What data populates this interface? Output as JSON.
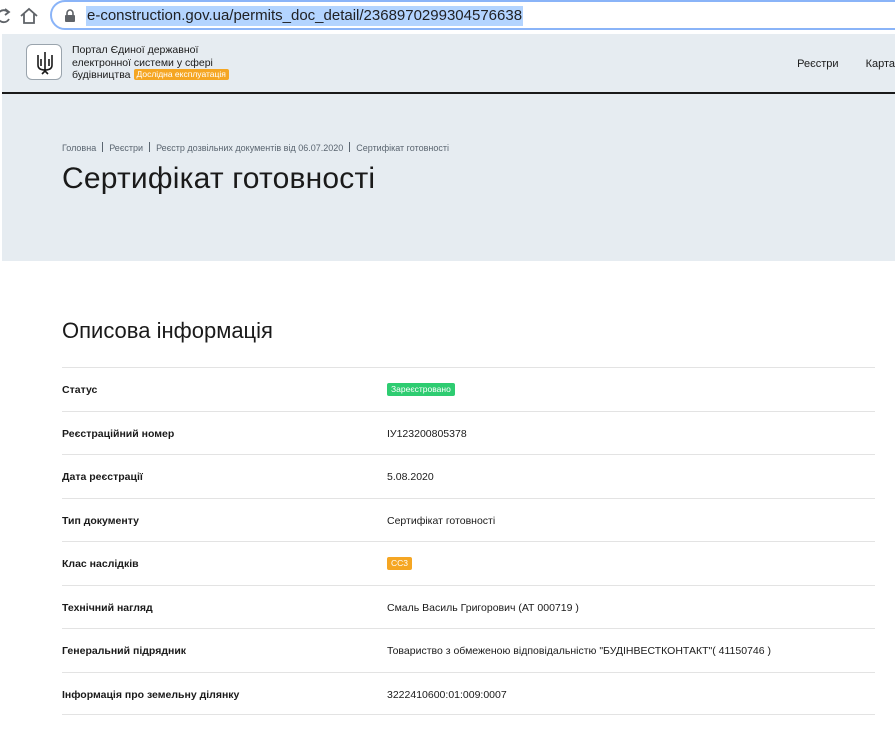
{
  "browser": {
    "url": "e-construction.gov.ua/permits_doc_detail/2368970299304576638",
    "reload_icon": "reload-icon",
    "home_icon": "home-icon",
    "lock_icon": "lock-icon"
  },
  "header": {
    "portal_name_lines": [
      "Портал Єдиної державної",
      "електронної системи у сфері",
      "будівництва"
    ],
    "beta_badge": "Дослідна експлуатація",
    "nav": [
      "Реєстри",
      "Карта"
    ],
    "emblem_icon": "trident-icon",
    "colors": {
      "header_bg": "#e6ecf1",
      "beta_badge": "#f5a623"
    }
  },
  "breadcrumb": [
    "Головна",
    "Реєстри",
    "Реєстр дозвільних документів від 06.07.2020",
    "Сертифікат готовності"
  ],
  "page_title": "Сертифікат готовності",
  "section_title": "Описова інформація",
  "rows": [
    {
      "label": "Статус",
      "value": "Зареєстровано",
      "badge": "green"
    },
    {
      "label": "Реєстраційний номер",
      "value": "ІУ123200805378"
    },
    {
      "label": "Дата реєстрації",
      "value": "5.08.2020"
    },
    {
      "label": "Тип документу",
      "value": "Сертифікат готовності"
    },
    {
      "label": "Клас наслідків",
      "value": "СС3",
      "badge": "orange"
    },
    {
      "label": "Технічний нагляд",
      "value": "Смаль Василь Григорович (АТ 000719 )"
    },
    {
      "label": "Генеральний підрядник",
      "value": "Товариство з обмеженою відповідальністю \"БУДІНВЕСТКОНТАКТ\"( 41150746 )"
    },
    {
      "label": "Інформація про земельну ділянку",
      "value": "3222410600:01:009:0007"
    }
  ],
  "badge_colors": {
    "green": "#2ecc71",
    "orange": "#f5a623"
  }
}
